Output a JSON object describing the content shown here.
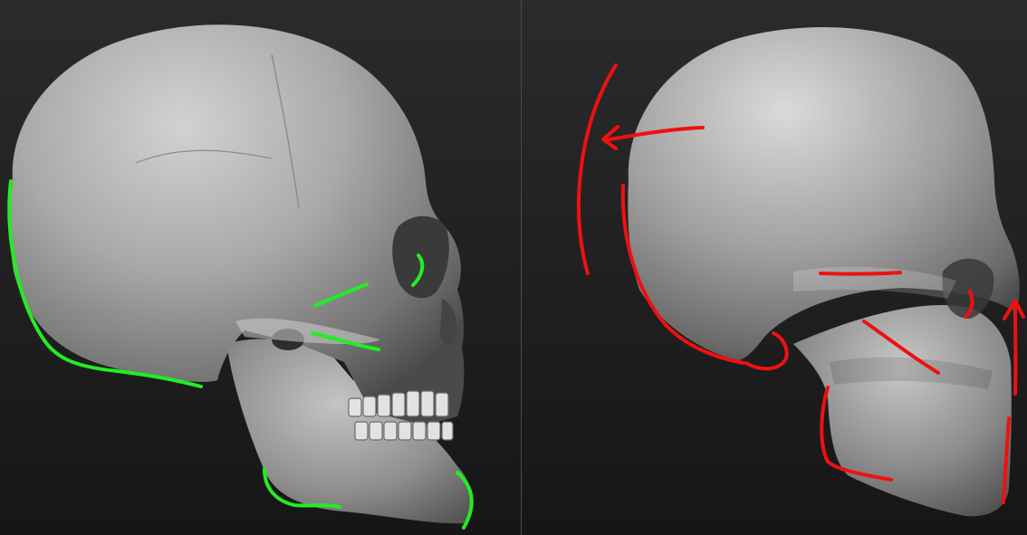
{
  "viewport": {
    "background": "#1f1f1f"
  },
  "left_panel": {
    "model": "detailed-skull",
    "annotation_color": "#22ee22"
  },
  "right_panel": {
    "model": "blockout-skull",
    "annotation_color": "#ee1111"
  }
}
